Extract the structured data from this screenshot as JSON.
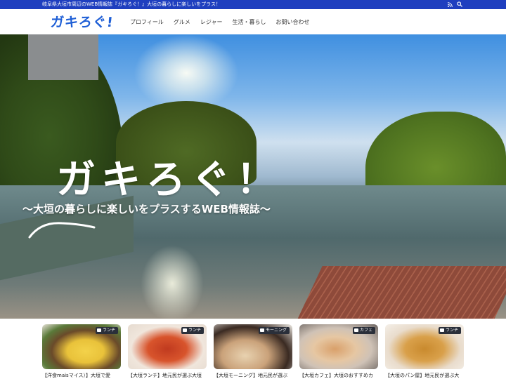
{
  "topbar": {
    "tagline": "岐阜県大垣市周辺のWEB情報誌『ガキろぐ！』大垣の暮らしに楽しいをプラス！",
    "icons": [
      "rss-icon",
      "search-icon"
    ]
  },
  "header": {
    "logo_text": "ガキろぐ!",
    "nav": [
      "プロフィール",
      "グルメ",
      "レジャー",
      "生活・暮らし",
      "お問い合わせ"
    ]
  },
  "hero": {
    "title": "ガキろぐ！",
    "subtitle": "〜大垣の暮らしに楽しいをプラスするWEB情報誌〜"
  },
  "cards": [
    {
      "badge": "ランチ",
      "title": "【洋食maisマイス）】大垣で愛"
    },
    {
      "badge": "ランチ",
      "title": "【大垣ランチ】地元民が選ぶ大垣"
    },
    {
      "badge": "モーニング",
      "title": "【大垣モーニング】地元民が選ぶ"
    },
    {
      "badge": "カフェ",
      "title": "【大垣カフェ】大垣のおすすめカ"
    },
    {
      "badge": "ランチ",
      "title": "【大垣のパン屋】地元民が選ぶ大"
    }
  ],
  "colors": {
    "topbar": "#1f3fbf",
    "logo": "#1f5fd6",
    "badge": "#2a2f3a"
  }
}
